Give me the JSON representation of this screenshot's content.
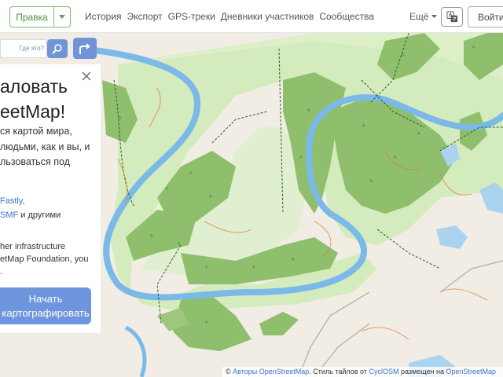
{
  "header": {
    "edit_label": "Правка",
    "nav_items": [
      "История",
      "Экспорт",
      "GPS-треки",
      "Дневники участников",
      "Сообщества"
    ],
    "more_label": "Ещё",
    "login_label": "Войти"
  },
  "search": {
    "placeholder": "Где это?"
  },
  "welcome": {
    "title_line1": "аловать",
    "title_line2": "eetMap!",
    "text_line1": "ся картой мира,",
    "text_line2": "людьми, как и вы, и",
    "text_line3": "льзоваться под",
    "host_prefix": "",
    "host_link1": "Fastly",
    "host_sep": ",",
    "host_link2": "SMF",
    "host_suffix": " и другими",
    "infra_line1": "her infrastructure",
    "infra_line2": "etMap Foundation, you",
    "infra_line3": ".",
    "start_line1": "Начать",
    "start_line2": "картографировать"
  },
  "attribution": {
    "prefix": "© ",
    "authors": "Авторы OpenStreetMap",
    "mid": ". Стиль тайлов от ",
    "cyclosm": "CyclOSM",
    "hosted": " размещен на ",
    "osm": "OpenStreetMap"
  },
  "colors": {
    "accent_green": "#7ebc6f",
    "button_blue": "#7094d5",
    "river": "#7ab9e8",
    "forest": "#8fbf6c",
    "meadow": "#d4ebbe"
  }
}
